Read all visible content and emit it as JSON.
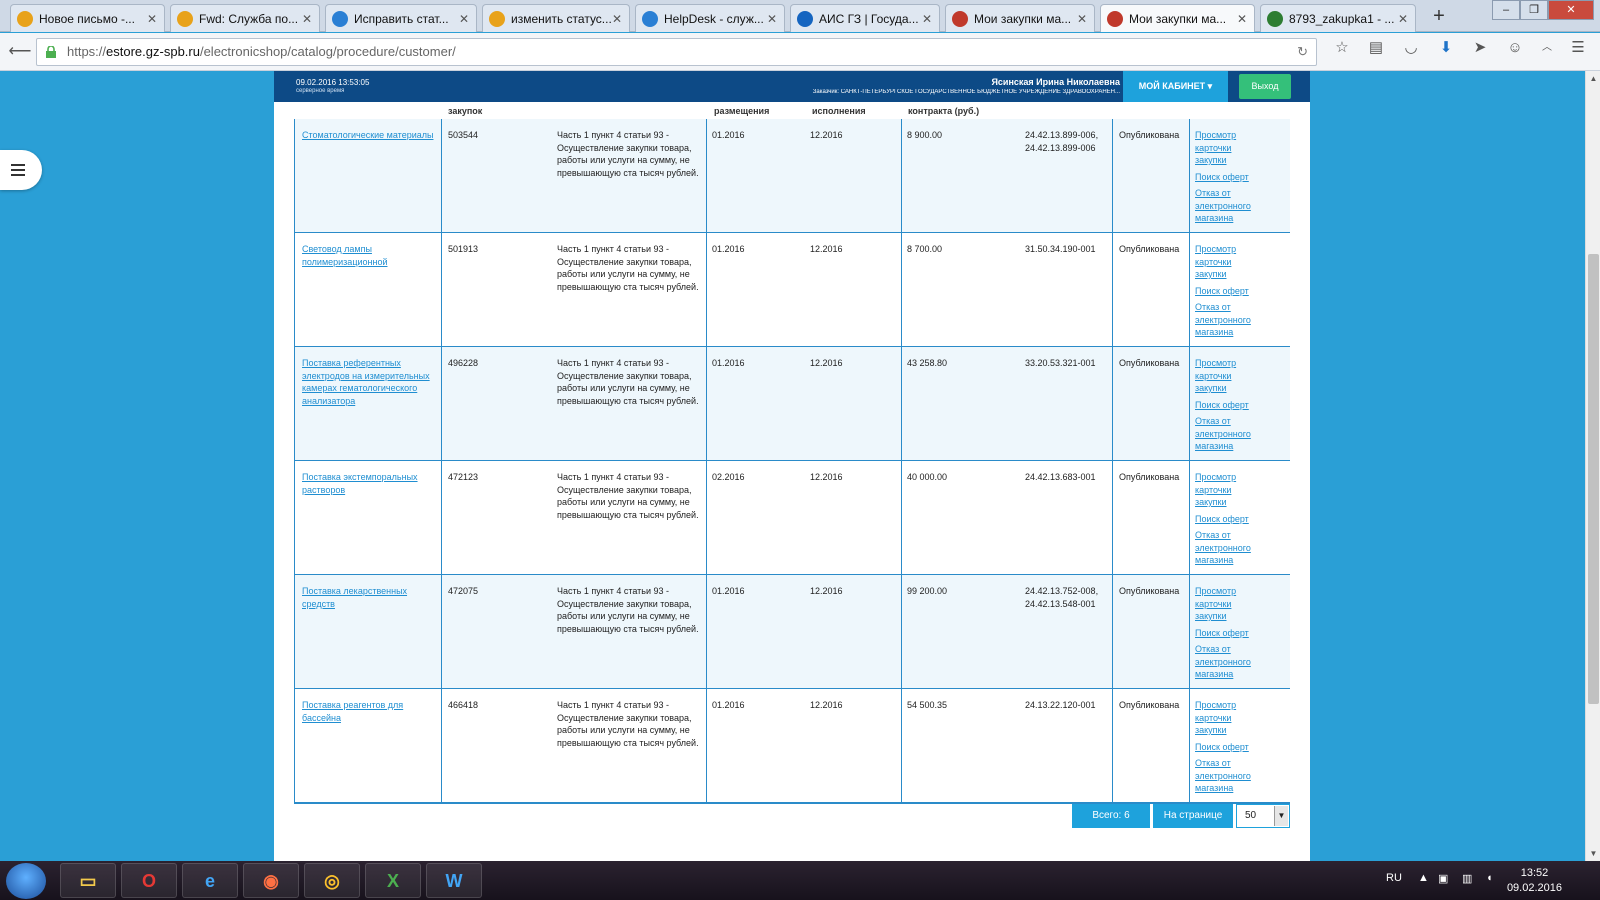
{
  "browser": {
    "tabs": [
      {
        "label": "Новое письмо -...",
        "icon": "mail-icon",
        "color": "#e8a21a"
      },
      {
        "label": "Fwd: Служба по...",
        "icon": "mail-icon",
        "color": "#e8a21a"
      },
      {
        "label": "Исправить стат...",
        "icon": "helpdesk-icon",
        "color": "#2a7fd4"
      },
      {
        "label": "изменить статус...",
        "icon": "mail-icon",
        "color": "#e8a21a"
      },
      {
        "label": "HelpDesk - служ...",
        "icon": "helpdesk-icon",
        "color": "#2a7fd4"
      },
      {
        "label": "АИС ГЗ | Госуда...",
        "icon": "ais-icon",
        "color": "#1565c0"
      },
      {
        "label": "Мои закупки ма...",
        "icon": "tools-icon",
        "color": "#c0392b"
      },
      {
        "label": "Мои закупки ма...",
        "icon": "tools-icon",
        "color": "#c0392b",
        "active": true
      },
      {
        "label": "8793_zakupka1 - ...",
        "icon": "sheet-icon",
        "color": "#2e7d32"
      }
    ],
    "new_tab": "+",
    "url_prefix": "https://",
    "url_host": "estore.gz-spb.ru",
    "url_path": "/electronicshop/catalog/procedure/customer/"
  },
  "header": {
    "datetime": "09.02.2016 13:53:05",
    "server_time_label": "серверное время",
    "user_name": "Ясинская Ирина Николаевна",
    "org": "Заказчик: САНКТ-ПЕТЕРБУРГСКОЕ ГОСУДАРСТВЕННОЕ БЮДЖЕТНОЕ УЧРЕЖДЕНИЕ ЗДРАВООХРАНЕН...",
    "cabinet_label": "МОЙ КАБИНЕТ ▾",
    "exit_label": "Выход"
  },
  "table": {
    "headers": [
      "закупок",
      "размещения",
      "исполнения",
      "контракта (руб.)"
    ],
    "rows": [
      {
        "name": "Стоматологические материалы",
        "number": "503544",
        "basis": "Часть 1 пункт 4 статьи 93 - Осуществление закупки товара, работы или услуги на сумму, не превышающую ста тысяч рублей.",
        "placement": "01.2016",
        "execution": "12.2016",
        "price": "8 900.00",
        "okpd": "24.42.13.899-006, 24.42.13.899-006",
        "status": "Опубликована"
      },
      {
        "name": "Световод лампы полимеризационной",
        "number": "501913",
        "basis": "Часть 1 пункт 4 статьи 93 - Осуществление закупки товара, работы или услуги на сумму, не превышающую ста тысяч рублей.",
        "placement": "01.2016",
        "execution": "12.2016",
        "price": "8 700.00",
        "okpd": "31.50.34.190-001",
        "status": "Опубликована"
      },
      {
        "name": "Поставка референтных электродов на измерительных камерах гематологического анализатора",
        "number": "496228",
        "basis": "Часть 1 пункт 4 статьи 93 - Осуществление закупки товара, работы или услуги на сумму, не превышающую ста тысяч рублей.",
        "placement": "01.2016",
        "execution": "12.2016",
        "price": "43 258.80",
        "okpd": "33.20.53.321-001",
        "status": "Опубликована"
      },
      {
        "name": "Поставка экстемпоральных растворов",
        "number": "472123",
        "basis": "Часть 1 пункт 4 статьи 93 - Осуществление закупки товара, работы или услуги на сумму, не превышающую ста тысяч рублей.",
        "placement": "02.2016",
        "execution": "12.2016",
        "price": "40 000.00",
        "okpd": "24.42.13.683-001",
        "status": "Опубликована"
      },
      {
        "name": "Поставка лекарственных средств",
        "number": "472075",
        "basis": "Часть 1 пункт 4 статьи 93 - Осуществление закупки товара, работы или услуги на сумму, не превышающую ста тысяч рублей.",
        "placement": "01.2016",
        "execution": "12.2016",
        "price": "99 200.00",
        "okpd": "24.42.13.752-008, 24.42.13.548-001",
        "status": "Опубликована"
      },
      {
        "name": "Поставка реагентов для бассейна",
        "number": "466418",
        "basis": "Часть 1 пункт 4 статьи 93 - Осуществление закупки товара, работы или услуги на сумму, не превышающую ста тысяч рублей.",
        "placement": "01.2016",
        "execution": "12.2016",
        "price": "54 500.35",
        "okpd": "24.13.22.120-001",
        "status": "Опубликована"
      }
    ],
    "action_labels": {
      "view": "Просмотр карточки закупки",
      "offers": "Поиск оферт",
      "refuse": "Отказ от электронного магазина"
    }
  },
  "pager": {
    "total": "Всего: 6",
    "per_page_label": "На странице",
    "per_page_value": "50"
  },
  "taskbar": {
    "apps": [
      "explorer-icon",
      "opera-icon",
      "ie-icon",
      "firefox-icon",
      "chrome-icon",
      "excel-icon",
      "word-icon"
    ],
    "lang": "RU",
    "time": "13:52",
    "date": "09.02.2016"
  },
  "colors": {
    "page_bg": "#2a9fd6",
    "header_bg": "#0d4a86",
    "accent": "#1ea2dc",
    "exit_green": "#34c07a",
    "link": "#1f8ed1",
    "table_border": "#2a8bc9"
  }
}
